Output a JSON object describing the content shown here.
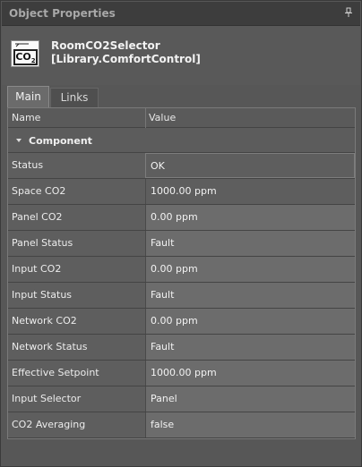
{
  "panel": {
    "title": "Object Properties",
    "pin_icon": "pin-icon"
  },
  "object": {
    "icon": "co2-selector-icon",
    "icon_text": "CO",
    "icon_sub": "2",
    "name_line1": "RoomCO2Selector",
    "name_line2": "[Library.ComfortControl]"
  },
  "tabs": [
    {
      "label": "Main",
      "active": true
    },
    {
      "label": "Links",
      "active": false
    }
  ],
  "columns": {
    "name": "Name",
    "value": "Value"
  },
  "category": {
    "label": "Component",
    "expanded": true
  },
  "rows": [
    {
      "name": "Status",
      "value": "OK"
    },
    {
      "name": "Space CO2",
      "value": "1000.00 ppm"
    },
    {
      "name": "Panel CO2",
      "value": "0.00 ppm"
    },
    {
      "name": "Panel Status",
      "value": "Fault"
    },
    {
      "name": "Input CO2",
      "value": "0.00 ppm"
    },
    {
      "name": "Input Status",
      "value": "Fault"
    },
    {
      "name": "Network CO2",
      "value": "0.00 ppm"
    },
    {
      "name": "Network Status",
      "value": "Fault"
    },
    {
      "name": "Effective Setpoint",
      "value": "1000.00 ppm"
    },
    {
      "name": "Input Selector",
      "value": "Panel"
    },
    {
      "name": "CO2 Averaging",
      "value": "false"
    }
  ]
}
